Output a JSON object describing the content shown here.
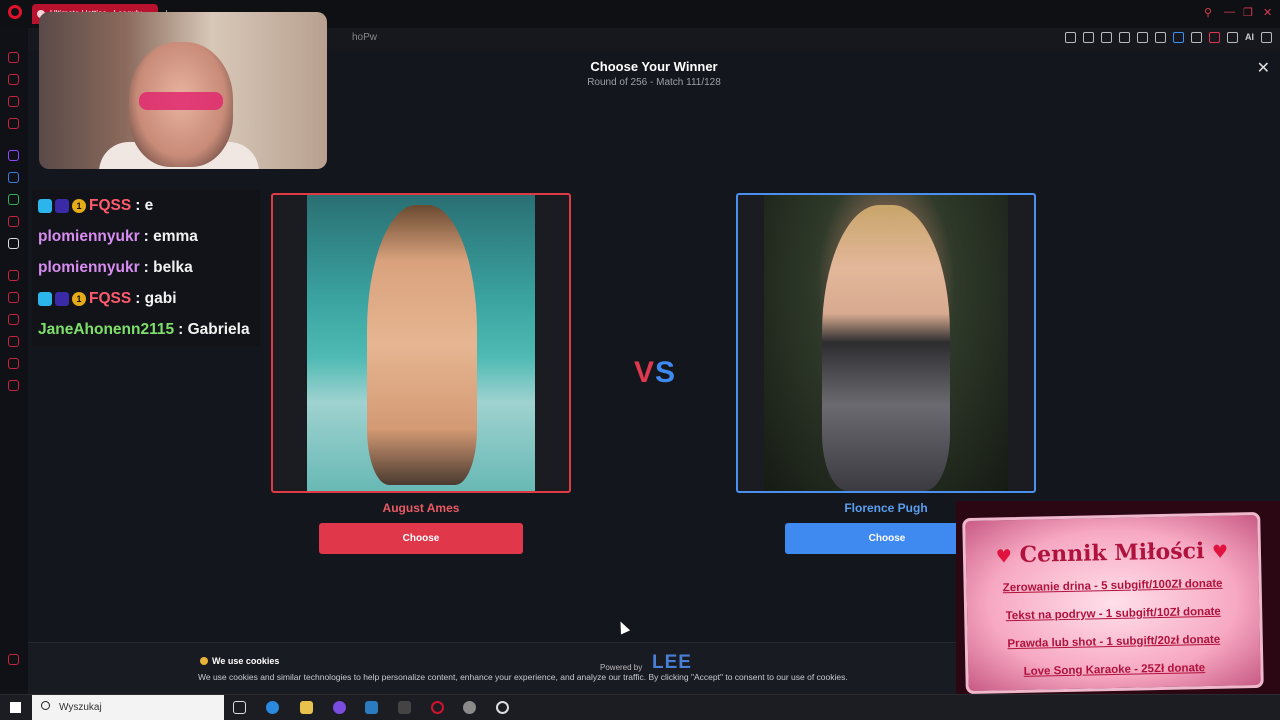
{
  "browser": {
    "tab_title": "Ultimate Hotties - Leaguly...",
    "url_fragment": "hoPw",
    "ai_label": "AI"
  },
  "page": {
    "title": "Choose Your Winner",
    "subtitle": "Round of 256 - Match 111/128",
    "vs_v": "V",
    "vs_s": "S",
    "left": {
      "name": "August Ames",
      "button": "Choose"
    },
    "right": {
      "name": "Florence Pugh",
      "button": "Choose"
    }
  },
  "cookie": {
    "title": "We use cookies",
    "body": "We use cookies and similar technologies to help personalize content, enhance your experience, and analyze our traffic. By clicking \"Accept\" to consent to our use of cookies.",
    "powered": "Powered by",
    "brand": "LEE"
  },
  "chat": [
    {
      "user": "FQSS",
      "message": ": e",
      "color": "#ff5a6e",
      "badges": true
    },
    {
      "user": "plomiennyukr",
      "message": ": emma",
      "color": "#d78cf0",
      "badges": false
    },
    {
      "user": "plomiennyukr",
      "message": ": belka",
      "color": "#d78cf0",
      "badges": false
    },
    {
      "user": "FQSS",
      "message": ": gabi",
      "color": "#ff5a6e",
      "badges": true
    },
    {
      "user": "JaneAhonenn2115",
      "message": ": Gabriela",
      "color": "#7ee06a",
      "badges": false
    }
  ],
  "promo": {
    "title": "Cennik Miłości",
    "lines": [
      "Zerowanie drina - 5 subgift/100Zł donate",
      "Tekst na podryw - 1 subgift/10Zł donate",
      "Prawda lub shot - 1 subgift/20zł donate",
      "Love Song Karaoke - 25Zł donate"
    ]
  },
  "taskbar": {
    "search_placeholder": "Wyszukaj"
  },
  "colors": {
    "accent_red": "#e0384a",
    "accent_blue": "#3f8af0",
    "background": "#14161d"
  }
}
